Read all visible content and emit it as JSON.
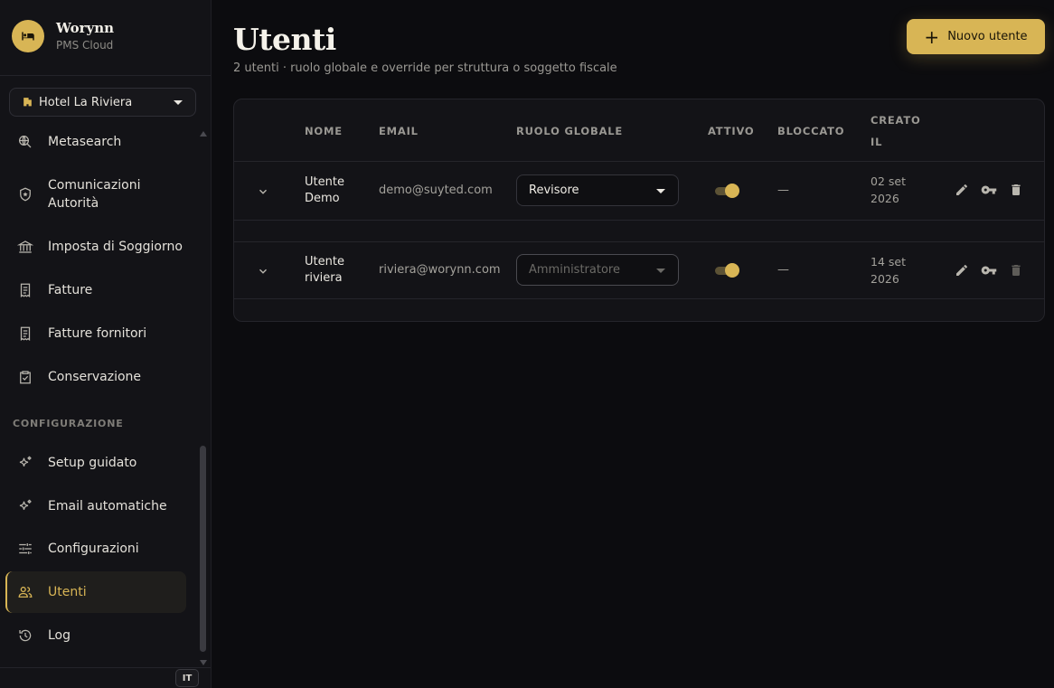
{
  "brand": {
    "name": "Worynn",
    "subtitle": "PMS Cloud"
  },
  "hotel_select": {
    "value": "Hotel La Riviera"
  },
  "sidebar": {
    "section_config": "CONFIGURAZIONE",
    "items": [
      {
        "label": "Metasearch",
        "icon": "search-globe-icon"
      },
      {
        "label": "Comunicazioni\nAutorità",
        "icon": "shield-star-icon"
      },
      {
        "label": "Imposta di Soggiorno",
        "icon": "bank-icon"
      },
      {
        "label": "Fatture",
        "icon": "receipt-icon"
      },
      {
        "label": "Fatture fornitori",
        "icon": "receipt-icon"
      },
      {
        "label": "Conservazione",
        "icon": "clipboard-check-icon"
      },
      {
        "label": "Setup guidato",
        "icon": "sparkle-icon"
      },
      {
        "label": "Email automatiche",
        "icon": "sparkle-icon"
      },
      {
        "label": "Configurazioni",
        "icon": "sliders-icon"
      },
      {
        "label": "Utenti",
        "icon": "users-icon",
        "active": true
      },
      {
        "label": "Log",
        "icon": "history-icon"
      }
    ],
    "language": "IT"
  },
  "page": {
    "title": "Utenti",
    "subtitle": "2 utenti · ruolo globale e override per struttura o soggetto fiscale",
    "new_button": "Nuovo utente"
  },
  "table": {
    "headers": {
      "nome": "NOME",
      "email": "EMAIL",
      "ruolo": "RUOLO GLOBALE",
      "attivo": "ATTIVO",
      "bloccato": "BLOCCATO",
      "creato_1": "CREATO",
      "creato_2": "IL"
    },
    "rows": [
      {
        "name_1": "Utente",
        "name_2": "Demo",
        "email": "demo@suyted.com",
        "role": "Revisore",
        "role_disabled": false,
        "active": true,
        "blocked": "—",
        "date_1": "02 set",
        "date_2": "2026"
      },
      {
        "name_1": "Utente",
        "name_2": "riviera",
        "email": "riviera@worynn.com",
        "role": "Amministratore",
        "role_disabled": true,
        "active": true,
        "blocked": "—",
        "date_1": "14 set",
        "date_2": "2026"
      }
    ]
  },
  "colors": {
    "accent": "#d8b555",
    "background": "#0c0c0f",
    "sidebar": "#131317"
  }
}
